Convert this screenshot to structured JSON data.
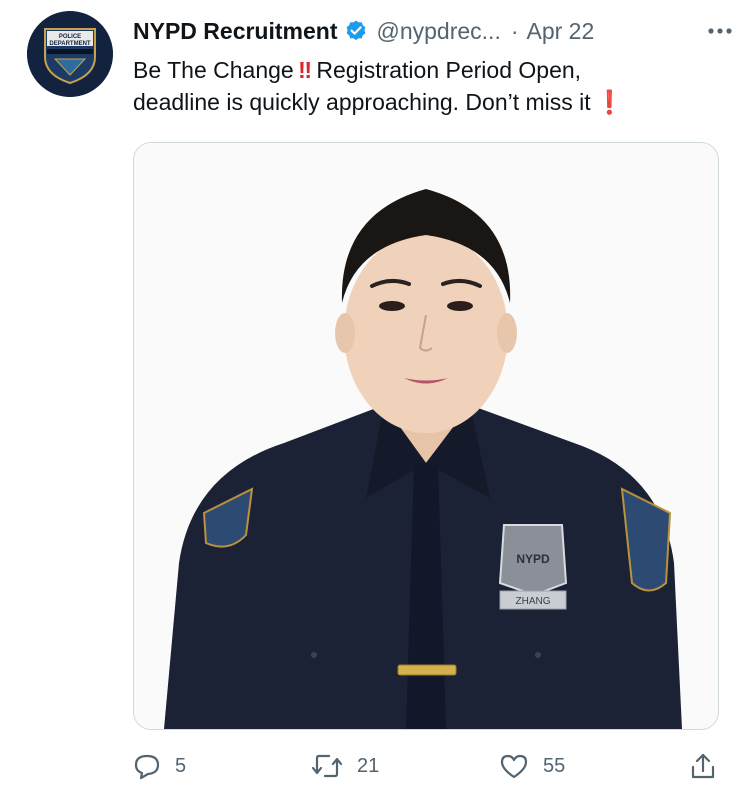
{
  "tweet": {
    "author": {
      "display_name": "NYPD Recruitment",
      "handle": "@nypdrec...",
      "verified": true,
      "avatar_text": [
        "POLICE",
        "DEPARTMENT"
      ]
    },
    "separator": "·",
    "date": "Apr 22",
    "text": {
      "part1": "Be The Change",
      "part2": " Registration Period Open,",
      "line2": "deadline is quickly approaching. Don’t miss it"
    },
    "media": {
      "badge_text": "NYPD",
      "nameplate_text": "ZHANG"
    },
    "stats": {
      "replies": "5",
      "retweets": "21",
      "likes": "55"
    }
  },
  "colors": {
    "verified_blue": "#1d9bf0",
    "text_primary": "#0f1419",
    "text_secondary": "#536471",
    "emoji_red": "#e0232c",
    "uniform_navy": "#1b2236"
  },
  "icons": [
    "verified-badge-icon",
    "more-options-icon",
    "reply-icon",
    "retweet-icon",
    "like-icon",
    "share-icon"
  ]
}
